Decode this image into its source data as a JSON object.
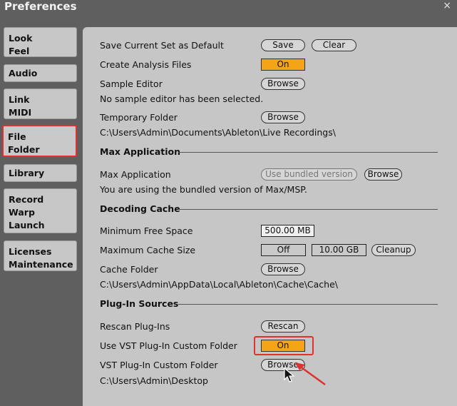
{
  "window": {
    "title": "Preferences",
    "close": "×"
  },
  "sidebar": {
    "items": [
      {
        "line1": "Look",
        "line2": "Feel"
      },
      {
        "line1": "Audio",
        "line2": ""
      },
      {
        "line1": "Link",
        "line2": "MIDI"
      },
      {
        "line1": "File",
        "line2": "Folder"
      },
      {
        "line1": "Library",
        "line2": ""
      },
      {
        "line1": "Record",
        "line2": "Warp",
        "line3": "Launch"
      },
      {
        "line1": "Licenses",
        "line2": "Maintenance"
      }
    ]
  },
  "rows": {
    "save_current": {
      "label": "Save Current Set as Default",
      "save": "Save",
      "clear": "Clear"
    },
    "analysis": {
      "label": "Create Analysis Files",
      "value": "On"
    },
    "sample_editor": {
      "label": "Sample Editor",
      "browse": "Browse",
      "note": "No sample editor has been selected."
    },
    "temp_folder": {
      "label": "Temporary Folder",
      "browse": "Browse",
      "path": "C:\\Users\\Admin\\Documents\\Ableton\\Live Recordings\\"
    }
  },
  "max": {
    "section": "Max Application",
    "label": "Max Application",
    "bundled": "Use bundled version",
    "browse": "Browse",
    "note": "You are using the bundled version of Max/MSP."
  },
  "cache": {
    "section": "Decoding Cache",
    "min_free_label": "Minimum Free Space",
    "min_free_value": "500.00 MB",
    "max_size_label": "Maximum Cache Size",
    "max_size_toggle": "Off",
    "max_size_value": "10.00 GB",
    "cleanup": "Cleanup",
    "folder_label": "Cache Folder",
    "folder_browse": "Browse",
    "folder_path": "C:\\Users\\Admin\\AppData\\Local\\Ableton\\Cache\\Cache\\"
  },
  "plugins": {
    "section": "Plug-In Sources",
    "rescan_label": "Rescan Plug-Ins",
    "rescan": "Rescan",
    "vst_custom_label": "Use VST Plug-In Custom Folder",
    "vst_custom_value": "On",
    "vst_folder_label": "VST Plug-In Custom Folder",
    "vst_folder_browse": "Browse",
    "vst_folder_path": "C:\\Users\\Admin\\Desktop"
  },
  "colors": {
    "accent_on": "#f5a418",
    "highlight": "#e03030"
  }
}
